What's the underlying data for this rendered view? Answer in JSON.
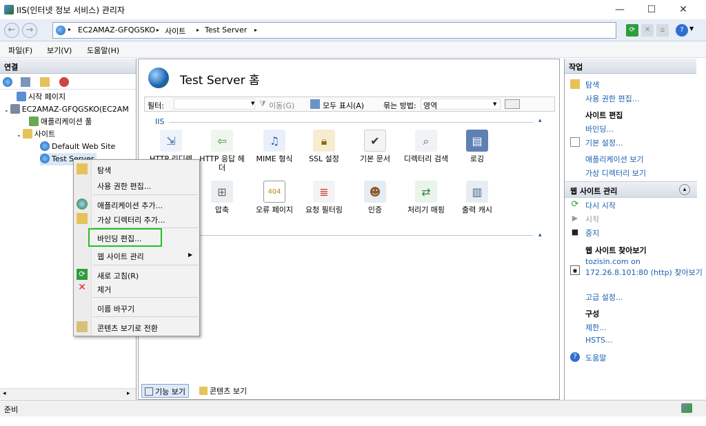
{
  "window": {
    "title": "IIS(인터넷 정보 서비스) 관리자",
    "minimize": "—",
    "maximize": "☐",
    "close": "✕"
  },
  "address": {
    "back": "←",
    "forward": "→",
    "crumbs": [
      "EC2AMAZ-GFQGSKO",
      "▸",
      "사이트",
      "▸",
      "Test Server",
      "▸"
    ]
  },
  "menubar": {
    "items": [
      "파일(F)",
      "보기(V)",
      "도움말(H)"
    ]
  },
  "left": {
    "header": "연결",
    "tree": [
      {
        "label": "시작 페이지"
      },
      {
        "label": "EC2AMAZ-GFQGSKO(EC2AM"
      },
      {
        "label": "애플리케이션 풀"
      },
      {
        "label": "사이트"
      },
      {
        "label": "Default Web Site"
      },
      {
        "label": "Test Server"
      }
    ]
  },
  "center": {
    "title": "Test Server 홈",
    "filter_label": "필터:",
    "move_label": "이동(G)",
    "show_all_label": "모두 표시(A)",
    "group_by_label": "묶는 방법:",
    "group_by_value": "영역",
    "group_name": "IIS",
    "features_row1": [
      "HTTP 리디렉",
      "HTTP 응답 헤더",
      "MIME 형식",
      "SSL 설정",
      "기본 문서",
      "디렉터리 검색",
      "로깅"
    ],
    "features_row2": [
      "압축",
      "오류 페이지",
      "요청 필터링",
      "인증",
      "처리기 매핑",
      "출력 캐시"
    ],
    "bottom_tabs": [
      "기능 보기",
      "콘텐츠 보기"
    ]
  },
  "right": {
    "header": "작업",
    "explore": "탐색",
    "edit_permissions": "사용 권한 편집...",
    "site_edit_hdr": "사이트 편집",
    "bindings": "바인딩...",
    "basic_settings": "기본 설정...",
    "view_apps": "애플리케이션 보기",
    "view_vdirs": "가상 디렉터리 보기",
    "manage_hdr": "웹 사이트 관리",
    "restart": "다시 시작",
    "start": "시작",
    "stop": "중지",
    "browse_hdr": "웹 사이트 찾아보기",
    "browse_link_1": "tozisin.com on",
    "browse_link_2": "172.26.8.101:80 (http) 찾아보기",
    "advanced": "고급 설정...",
    "config_hdr": "구성",
    "limits": "제한...",
    "hsts": "HSTS...",
    "help": "도움말"
  },
  "context_menu": {
    "items": [
      "탐색",
      "사용 권한 편집...",
      "애플리케이션 추가...",
      "가상 디렉터리 추가...",
      "바인딩 편집...",
      "웹 사이트 관리",
      "새로 고침(R)",
      "제거",
      "이름 바꾸기",
      "콘텐츠 보기로 전환"
    ],
    "highlight_color": "#22c022"
  },
  "status": {
    "text": "준비"
  }
}
